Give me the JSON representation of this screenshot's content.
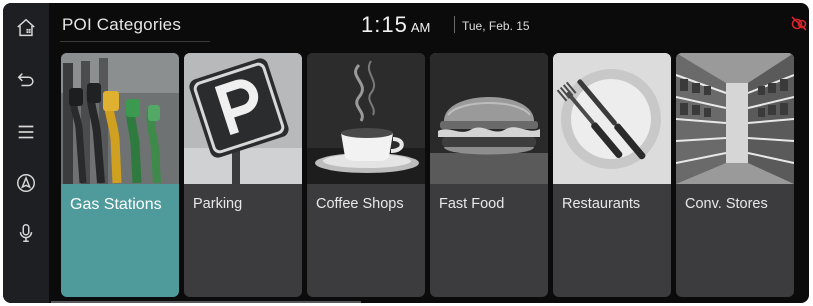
{
  "header": {
    "title": "POI Categories",
    "time": "1:15",
    "ampm": "AM",
    "date": "Tue, Feb. 15"
  },
  "colors": {
    "background": "#0b0b0c",
    "rail": "#1e1f22",
    "card": "#3c3c3e",
    "selected_card": "#4f9a9b",
    "status_icon": "#d6232a"
  },
  "sidebar": {
    "items": [
      {
        "icon": "home-icon"
      },
      {
        "icon": "back-icon"
      },
      {
        "icon": "menu-icon"
      },
      {
        "icon": "navigation-icon"
      },
      {
        "icon": "microphone-icon"
      }
    ]
  },
  "categories": [
    {
      "label": "Gas Stations",
      "selected": true,
      "icon": "gas-pump-photo"
    },
    {
      "label": "Parking",
      "selected": false,
      "icon": "parking-sign-photo"
    },
    {
      "label": "Coffee Shops",
      "selected": false,
      "icon": "coffee-cup-photo"
    },
    {
      "label": "Fast Food",
      "selected": false,
      "icon": "burger-photo"
    },
    {
      "label": "Restaurants",
      "selected": false,
      "icon": "plate-cutlery-photo"
    },
    {
      "label": "Conv. Stores",
      "selected": false,
      "icon": "store-shelves-photo"
    }
  ]
}
